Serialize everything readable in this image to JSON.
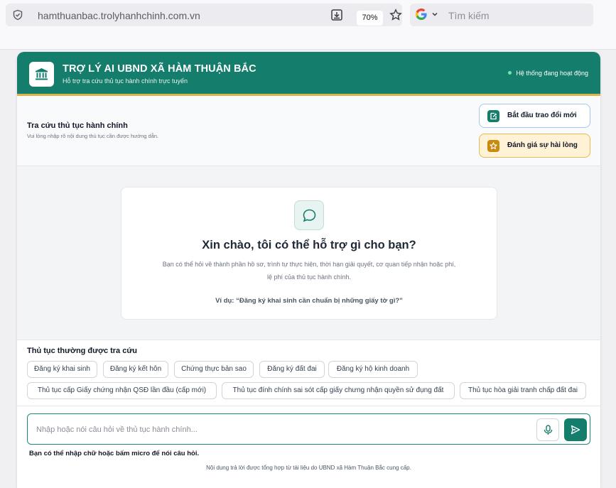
{
  "browser": {
    "url": "hamthuanbac.trolyhanhchinh.com.vn",
    "zoom": "70%",
    "search_placeholder": "Tìm kiếm"
  },
  "header": {
    "title": "TRỢ LÝ AI UBND XÃ HÀM THUẬN BẮC",
    "subtitle": "Hỗ trợ tra cứu thủ tục hành chính trực tuyến",
    "status": "Hệ thống đang hoạt động"
  },
  "toolbar": {
    "title": "Tra cứu thủ tục hành chính",
    "subtitle": "Vui lòng nhập rõ nội dung thủ tục cần được hướng dẫn.",
    "new_chat_label": "Bắt đầu trao đổi mới",
    "rate_label": "Đánh giá sự hài lòng"
  },
  "welcome": {
    "title": "Xin chào, tôi có thể hỗ trợ gì cho bạn?",
    "line1": "Bạn có thể hỏi về thành phần hồ sơ, trình tự thực hiện, thời hạn giải quyết, cơ quan tiếp nhận hoặc phí,",
    "line2": "lệ phí của thủ tục hành chính.",
    "example": "Ví dụ: “Đăng ký khai sinh cần chuẩn bị những giấy tờ gì?”"
  },
  "common": {
    "title": "Thủ tục thường được tra cứu",
    "chips": [
      "Đăng ký khai sinh",
      "Đăng ký kết hôn",
      "Chứng thực bản sao",
      "Đăng ký đất đai",
      "Đăng ký hộ kinh doanh",
      "Thủ tục cấp Giấy chứng nhận QSĐ lần đầu (cấp mới)",
      "Thủ tục đính chính sai sót cấp giấy chưng nhận quyền sử đụng đất",
      "Thủ tục hòa giải tranh chấp đất đai"
    ]
  },
  "input": {
    "placeholder": "Nhập hoặc nói câu hỏi về thủ tục hành chính...",
    "value": "",
    "hint": "Bạn có thể nhập chữ hoặc bấm micro để nói câu hỏi.",
    "footer": "Nội dung trả lời được tổng hợp từ tài liệu do UBND xã Hàm Thuận Bắc cung cấp."
  },
  "colors": {
    "primary": "#157d6b",
    "accent_gold": "#e0b24a",
    "rate_bg": "#fff2d6"
  }
}
